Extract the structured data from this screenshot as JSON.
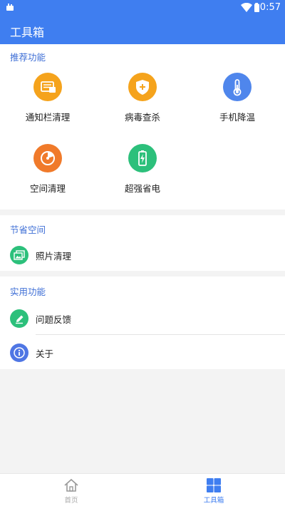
{
  "status_bar": {
    "time": "10:57"
  },
  "app_bar": {
    "title": "工具箱"
  },
  "recommended": {
    "title": "推荐功能",
    "items": [
      {
        "label": "通知栏清理",
        "icon": "notification-clean-icon",
        "color": "#f5a31c"
      },
      {
        "label": "病毒查杀",
        "icon": "shield-plus-icon",
        "color": "#f5a31c"
      },
      {
        "label": "手机降温",
        "icon": "thermometer-icon",
        "color": "#4f86ec"
      },
      {
        "label": "空间清理",
        "icon": "disk-gauge-icon",
        "color": "#f07a2a"
      },
      {
        "label": "超强省电",
        "icon": "battery-bolt-icon",
        "color": "#2cc07b"
      }
    ]
  },
  "save_space": {
    "title": "节省空间",
    "items": [
      {
        "label": "照片清理",
        "icon": "photos-icon",
        "color": "#2cc07b"
      }
    ]
  },
  "utilities": {
    "title": "实用功能",
    "items": [
      {
        "label": "问题反馈",
        "icon": "pencil-icon",
        "color": "#2cc07b"
      },
      {
        "label": "关于",
        "icon": "info-icon",
        "color": "#4f76e4"
      }
    ]
  },
  "bottom_nav": {
    "tabs": [
      {
        "label": "首页",
        "icon": "home-icon",
        "active": false
      },
      {
        "label": "工具箱",
        "icon": "grid-icon",
        "active": true
      }
    ]
  }
}
